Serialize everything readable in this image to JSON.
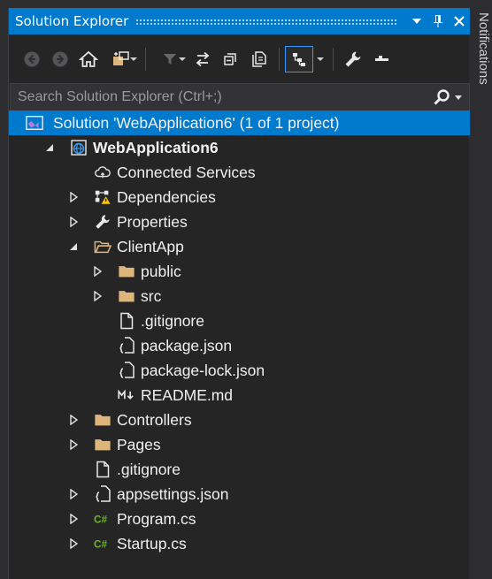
{
  "panel": {
    "title": "Solution Explorer"
  },
  "search": {
    "placeholder": "Search Solution Explorer (Ctrl+;)"
  },
  "side_tab": {
    "label": "Notifications"
  },
  "tree": [
    {
      "label": "Solution 'WebApplication6' (1 of 1 project)",
      "icon": "solution-icon",
      "expander": "none",
      "selected": true
    },
    {
      "label": "WebApplication6",
      "icon": "web-project-icon",
      "expander": "expanded",
      "bold": true
    },
    {
      "label": "Connected Services",
      "icon": "cloud-icon",
      "expander": "none"
    },
    {
      "label": "Dependencies",
      "icon": "dependencies-icon",
      "expander": "collapsed"
    },
    {
      "label": "Properties",
      "icon": "wrench-icon",
      "expander": "collapsed"
    },
    {
      "label": "ClientApp",
      "icon": "folder-open-icon",
      "expander": "expanded"
    },
    {
      "label": "public",
      "icon": "folder-icon",
      "expander": "collapsed"
    },
    {
      "label": "src",
      "icon": "folder-icon",
      "expander": "collapsed"
    },
    {
      "label": ".gitignore",
      "icon": "file-icon",
      "expander": "none"
    },
    {
      "label": "package.json",
      "icon": "json-file-icon",
      "expander": "none"
    },
    {
      "label": "package-lock.json",
      "icon": "json-file-icon",
      "expander": "none"
    },
    {
      "label": "README.md",
      "icon": "markdown-icon",
      "expander": "none"
    },
    {
      "label": "Controllers",
      "icon": "folder-icon",
      "expander": "collapsed"
    },
    {
      "label": "Pages",
      "icon": "folder-icon",
      "expander": "collapsed"
    },
    {
      "label": ".gitignore",
      "icon": "file-icon",
      "expander": "none"
    },
    {
      "label": "appsettings.json",
      "icon": "json-file-icon",
      "expander": "collapsed"
    },
    {
      "label": "Program.cs",
      "icon": "csharp-file-icon",
      "expander": "collapsed"
    },
    {
      "label": "Startup.cs",
      "icon": "csharp-file-icon",
      "expander": "collapsed"
    }
  ],
  "colors": {
    "accent": "#007acc",
    "background": "#252526",
    "folder": "#dcb67a",
    "csharp": "#68b723"
  }
}
